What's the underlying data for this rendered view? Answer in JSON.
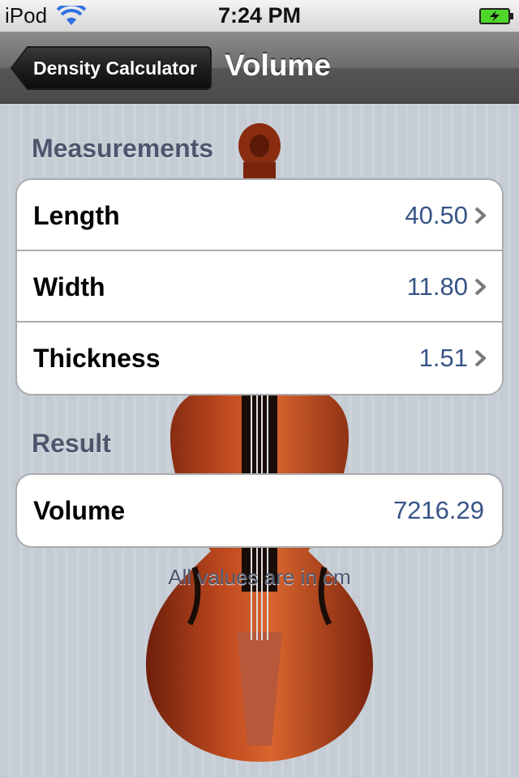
{
  "status_bar": {
    "carrier": "iPod",
    "time": "7:24 PM",
    "wifi_icon": "wifi-icon",
    "battery_icon": "battery-charging-icon"
  },
  "nav": {
    "back_label": "Density Calculator",
    "title": "Volume"
  },
  "measurements": {
    "header": "Measurements",
    "rows": [
      {
        "label": "Length",
        "value": "40.50",
        "icon": "chevron-right-icon"
      },
      {
        "label": "Width",
        "value": "11.80",
        "icon": "chevron-right-icon"
      },
      {
        "label": "Thickness",
        "value": "1.51",
        "icon": "chevron-right-icon"
      }
    ]
  },
  "result": {
    "header": "Result",
    "label": "Volume",
    "value": "7216.29"
  },
  "footer_note": "All values are in cm",
  "colors": {
    "value_text": "#385487",
    "section_header": "#4c566c",
    "battery_fill": "#4fd62a"
  }
}
